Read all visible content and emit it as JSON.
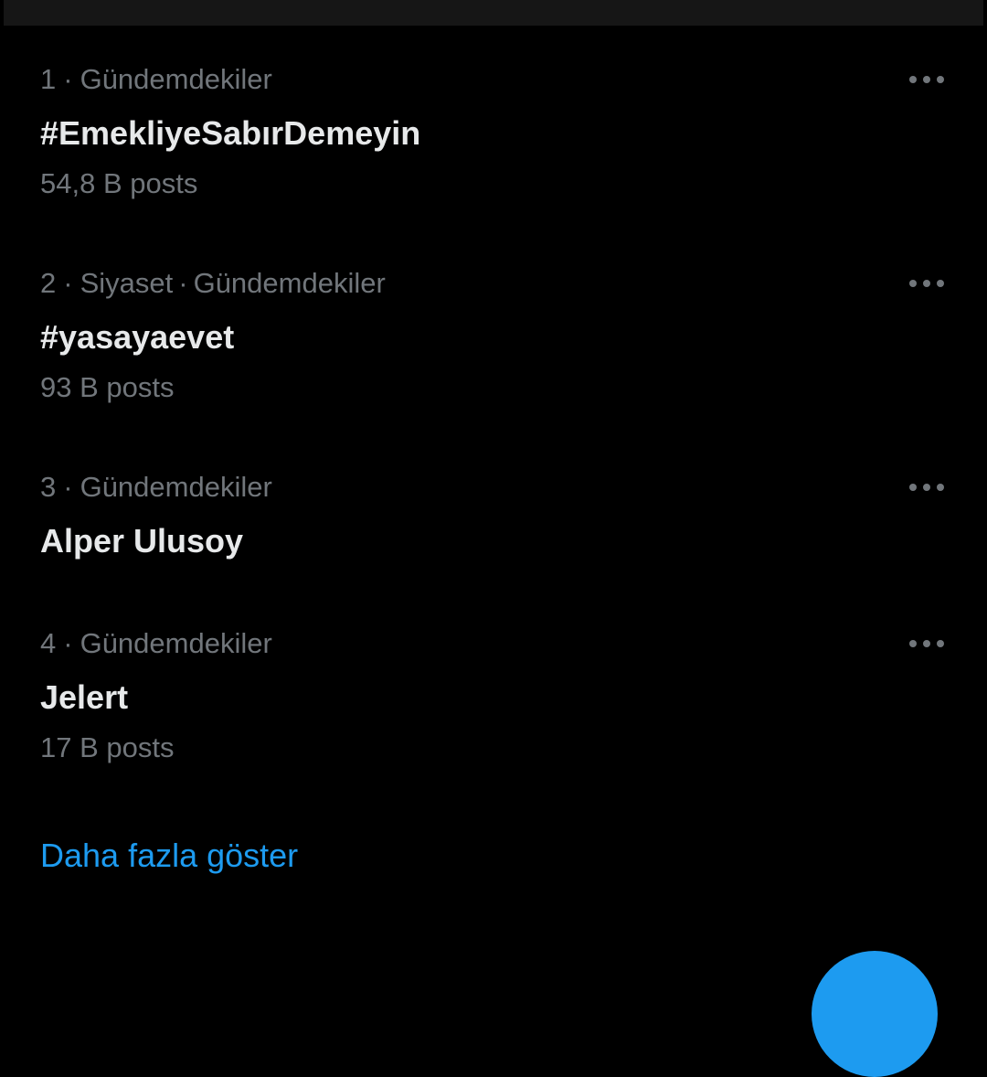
{
  "trends": [
    {
      "rank": "1",
      "category": "",
      "context": "Gündemdekiler",
      "name": "#EmekliyeSabırDemeyin",
      "posts": "54,8 B posts"
    },
    {
      "rank": "2",
      "category": "Siyaset",
      "context": "Gündemdekiler",
      "name": "#yasayaevet",
      "posts": "93 B posts"
    },
    {
      "rank": "3",
      "category": "",
      "context": "Gündemdekiler",
      "name": "Alper Ulusoy",
      "posts": ""
    },
    {
      "rank": "4",
      "category": "",
      "context": "Gündemdekiler",
      "name": "Jelert",
      "posts": "17 B posts"
    }
  ],
  "separator": "·",
  "show_more_label": "Daha fazla göster",
  "icons": {
    "more": "more-horizontal-icon",
    "compose": "compose-fab"
  },
  "colors": {
    "background": "#000000",
    "primary_text": "#e7e9ea",
    "secondary_text": "#71767b",
    "accent": "#1d9bf0"
  }
}
